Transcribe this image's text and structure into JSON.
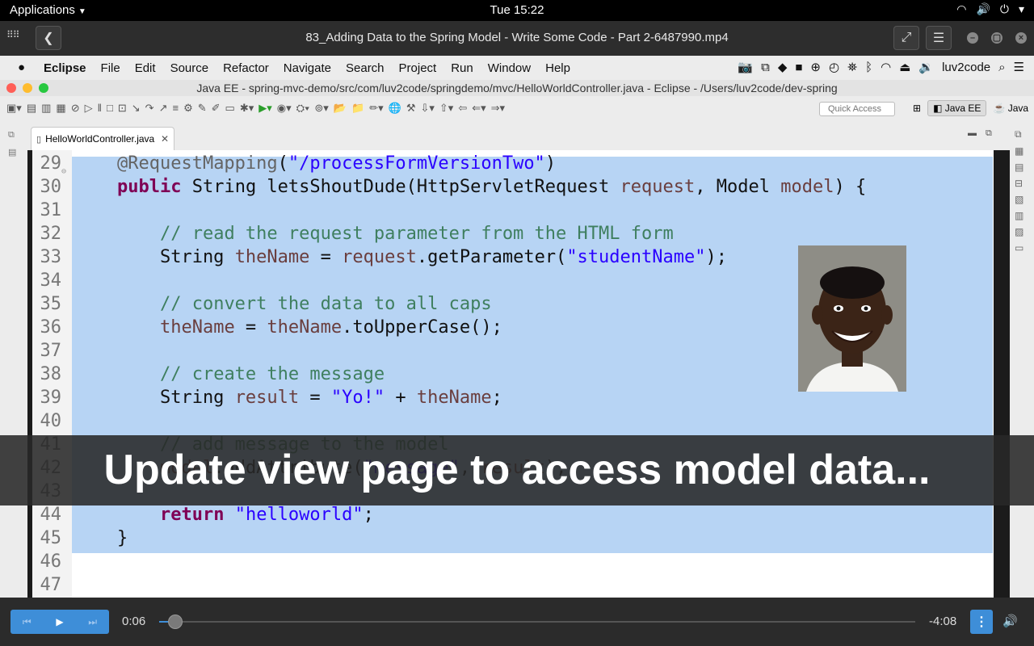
{
  "topbar": {
    "applications": "Applications",
    "clock": "Tue 15:22"
  },
  "player_window": {
    "title": "83_Adding Data to the Spring Model - Write Some Code - Part 2-6487990.mp4"
  },
  "mac_menu": {
    "items": [
      "Eclipse",
      "File",
      "Edit",
      "Source",
      "Refactor",
      "Navigate",
      "Search",
      "Project",
      "Run",
      "Window",
      "Help"
    ],
    "user": "luv2code"
  },
  "eclipse_window": {
    "title": "Java EE - spring-mvc-demo/src/com/luv2code/springdemo/mvc/HelloWorldController.java - Eclipse - /Users/luv2code/dev-spring"
  },
  "toolbar": {
    "quick_access_placeholder": "Quick Access",
    "perspective_active": "Java EE",
    "perspective_other": "Java"
  },
  "editor": {
    "tab": "HelloWorldController.java",
    "lines": [
      {
        "n": "29",
        "parts": [
          [
            "",
            "    "
          ],
          [
            "ann",
            "@RequestMapping"
          ],
          [
            "",
            "("
          ],
          [
            "str",
            "\"/processFormVersionTwo\""
          ],
          [
            "",
            ")"
          ]
        ]
      },
      {
        "n": "30",
        "parts": [
          [
            "",
            "    "
          ],
          [
            "kw",
            "public"
          ],
          [
            "",
            " String letsShoutDude(HttpServletRequest "
          ],
          [
            "var",
            "request"
          ],
          [
            "",
            ", Model "
          ],
          [
            "var",
            "model"
          ],
          [
            "",
            ") {"
          ]
        ]
      },
      {
        "n": "31",
        "parts": []
      },
      {
        "n": "32",
        "parts": [
          [
            "",
            "        "
          ],
          [
            "cm",
            "// read the request parameter from the HTML form"
          ]
        ]
      },
      {
        "n": "33",
        "parts": [
          [
            "",
            "        String "
          ],
          [
            "var",
            "theName"
          ],
          [
            "",
            " = "
          ],
          [
            "var",
            "request"
          ],
          [
            "",
            ".getParameter("
          ],
          [
            "str",
            "\"studentName\""
          ],
          [
            "",
            ");"
          ]
        ]
      },
      {
        "n": "34",
        "parts": []
      },
      {
        "n": "35",
        "parts": [
          [
            "",
            "        "
          ],
          [
            "cm",
            "// convert the data to all caps"
          ]
        ]
      },
      {
        "n": "36",
        "parts": [
          [
            "",
            "        "
          ],
          [
            "var",
            "theName"
          ],
          [
            "",
            " = "
          ],
          [
            "var",
            "theName"
          ],
          [
            "",
            ".toUpperCase();"
          ]
        ]
      },
      {
        "n": "37",
        "parts": []
      },
      {
        "n": "38",
        "parts": [
          [
            "",
            "        "
          ],
          [
            "cm",
            "// create the message"
          ]
        ]
      },
      {
        "n": "39",
        "parts": [
          [
            "",
            "        String "
          ],
          [
            "var",
            "result"
          ],
          [
            "",
            " = "
          ],
          [
            "str",
            "\"Yo!\""
          ],
          [
            "",
            " + "
          ],
          [
            "var",
            "theName"
          ],
          [
            "",
            ";"
          ]
        ]
      },
      {
        "n": "40",
        "parts": []
      },
      {
        "n": "41",
        "parts": [
          [
            "",
            "        "
          ],
          [
            "cm",
            "// add message to the model"
          ]
        ]
      },
      {
        "n": "42",
        "parts": [
          [
            "",
            "        "
          ],
          [
            "var",
            "model"
          ],
          [
            "",
            ".addAttribute("
          ],
          [
            "str",
            "\"message\""
          ],
          [
            "",
            ", "
          ],
          [
            "var",
            "result"
          ],
          [
            "",
            ");"
          ]
        ]
      },
      {
        "n": "43",
        "parts": []
      },
      {
        "n": "44",
        "parts": [
          [
            "",
            "        "
          ],
          [
            "kw",
            "return"
          ],
          [
            "",
            " "
          ],
          [
            "str",
            "\"helloworld\""
          ],
          [
            "",
            ";"
          ]
        ]
      },
      {
        "n": "45",
        "parts": [
          [
            "",
            "    }"
          ]
        ]
      },
      {
        "n": "46",
        "parts": []
      },
      {
        "n": "47",
        "parts": []
      }
    ]
  },
  "caption": "Update view page to access model data...",
  "player": {
    "elapsed": "0:06",
    "remaining": "-4:08",
    "progress_fraction": 0.016
  },
  "colors": {
    "selection": "#b7d4f4",
    "player_accent": "#3e8ed8",
    "keyword": "#7f0055",
    "comment": "#3f7f5f",
    "string": "#2a00ff",
    "variable": "#6a3e3e"
  }
}
